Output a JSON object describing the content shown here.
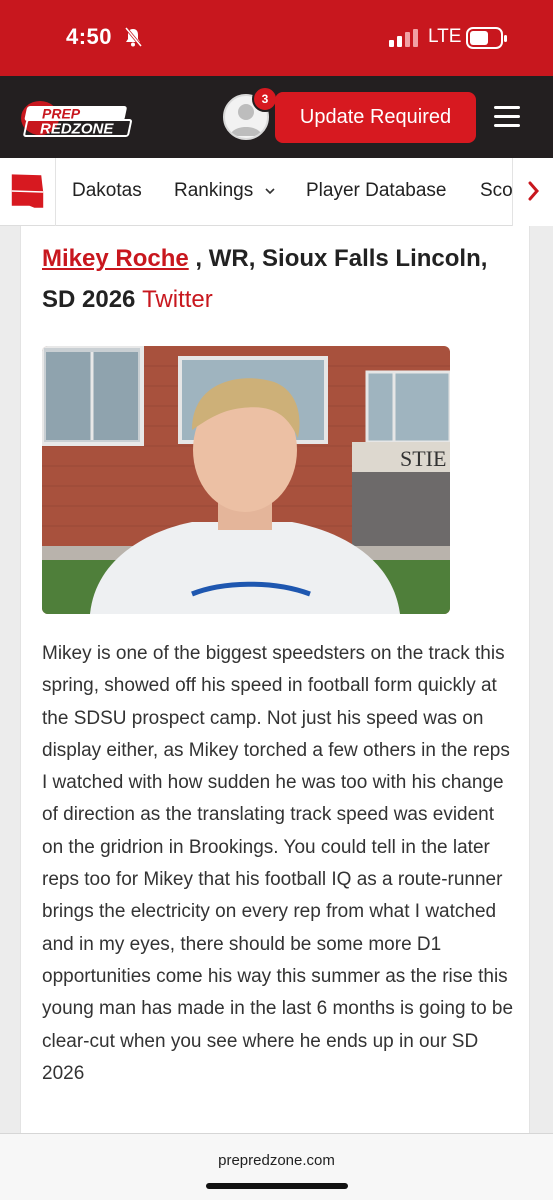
{
  "status": {
    "time": "4:50",
    "network": "LTE"
  },
  "header": {
    "logo_top": "PREP",
    "logo_bottom": "REDZONE",
    "notifications": "3",
    "update_label": "Update Required"
  },
  "nav": {
    "items": [
      "Dakotas",
      "Rankings",
      "Player Database",
      "Sco"
    ]
  },
  "article": {
    "player_name": "Mikey Roche",
    "player_info": " , WR, Sioux Falls Lincoln, SD 2026 ",
    "twitter_label": "Twitter",
    "photo_sign": "STIE",
    "body": "Mikey is one of the biggest speedsters on the track this spring, showed off his speed in football form quickly at the SDSU prospect camp. Not just his speed was on display either, as Mikey torched a few others in the reps I watched with how sudden he was too with his change of direction as the translating track speed was evident on the gridrion in Brookings. You could tell in the later reps too for Mikey that his football IQ as a route-runner brings the electricity on every rep from what I watched and in my eyes, there should be some more D1 opportunities come his way this summer as the rise this young man has made in the last 6 months is going to be clear-cut when you see where he ends up in our SD 2026"
  },
  "browser": {
    "url": "prepredzone.com"
  },
  "colors": {
    "brand_red": "#c8171e",
    "header_dark": "#231f20"
  }
}
